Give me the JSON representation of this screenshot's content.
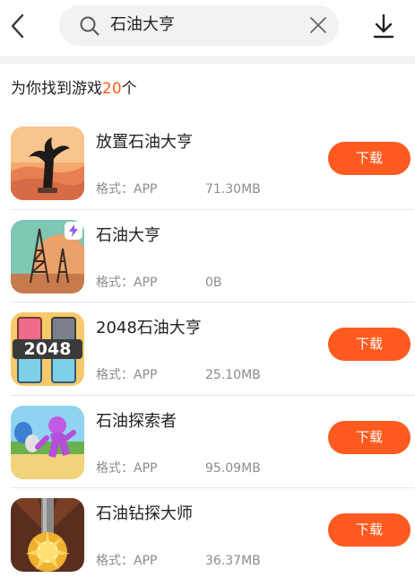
{
  "search": {
    "query": "石油大亨"
  },
  "results": {
    "prefix": "为你找到游戏",
    "count": "20",
    "suffix": "个"
  },
  "accent_color": "#ff5a1f",
  "apps": [
    {
      "name": "放置石油大亨",
      "format_label": "格式：APP",
      "size": "71.30MB",
      "download_label": "下载",
      "icon": "oil-gusher-desert-icon"
    },
    {
      "name": "石油大亨",
      "format_label": "格式：APP",
      "size": "0B",
      "download_label": "",
      "icon": "oil-derrick-icon"
    },
    {
      "name": "2048石油大亨",
      "format_label": "格式：APP",
      "size": "25.10MB",
      "download_label": "下载",
      "icon": "2048-barrels-icon"
    },
    {
      "name": "石油探索者",
      "format_label": "格式：APP",
      "size": "95.09MB",
      "download_label": "下载",
      "icon": "purple-runner-icon"
    },
    {
      "name": "石油钻探大师",
      "format_label": "格式：APP",
      "size": "36.37MB",
      "download_label": "下载",
      "icon": "drill-explosion-icon"
    }
  ]
}
